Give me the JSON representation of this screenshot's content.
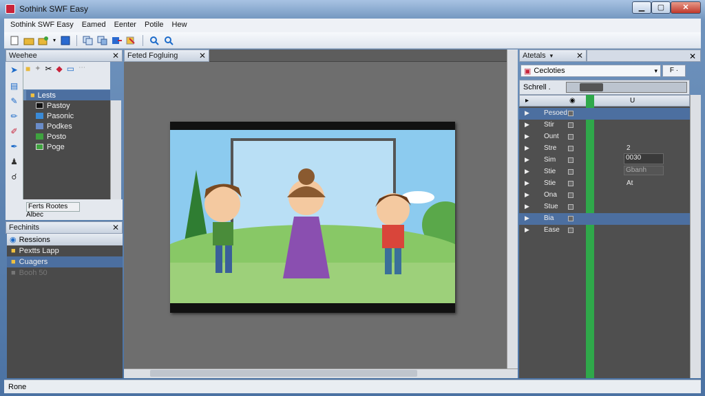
{
  "window": {
    "title": "Sothink SWF Easy",
    "minimize": "▁",
    "maximize": "▢",
    "close": "✕"
  },
  "menu": [
    "Sothink SWF Easy",
    "Eamed",
    "Eenter",
    "Potile",
    "Hew"
  ],
  "left_panel": {
    "title": "Weehee",
    "tree_header": "Lests",
    "tree_items": [
      {
        "label": "Pastoy",
        "color": "#111111"
      },
      {
        "label": "Pasonic",
        "color": "#3a8ad6"
      },
      {
        "label": "Podkes",
        "color": "#6a8cc8"
      },
      {
        "label": "Posto",
        "color": "#3fa33f"
      },
      {
        "label": "Poge",
        "color": "#3fa33f"
      }
    ],
    "bottom_label": "Ferts Rootes",
    "bottom_sub": "Albec"
  },
  "left_panel2": {
    "title": "Fechinits",
    "subheader": "Ressions",
    "rows": [
      {
        "label": "Pextts Lapp",
        "selected": false,
        "dim": false
      },
      {
        "label": "Cuagers",
        "selected": true,
        "dim": false
      },
      {
        "label": "Booh 50",
        "selected": false,
        "dim": true
      }
    ]
  },
  "document": {
    "tab": "Feted Fogluing"
  },
  "right_panel": {
    "title": "Atetals",
    "dropdown": "Cecloties",
    "dropdown_btn": "F ·",
    "toolbar_label": "Schrell .",
    "header_icon": "U",
    "layers": [
      {
        "name": "Pesoed",
        "selected": true,
        "value": ""
      },
      {
        "name": "Stir",
        "selected": false,
        "value": ""
      },
      {
        "name": "Ount",
        "selected": false,
        "value": ""
      },
      {
        "name": "Stre",
        "selected": false,
        "value": "2"
      },
      {
        "name": "Sim",
        "selected": false,
        "value": ""
      },
      {
        "name": "Stie",
        "selected": false,
        "value": ""
      },
      {
        "name": "Stie",
        "selected": false,
        "value": "At"
      },
      {
        "name": "Ona",
        "selected": false,
        "value": ""
      },
      {
        "name": "Stue",
        "selected": false,
        "value": ""
      },
      {
        "name": "Bia",
        "selected": true,
        "value": ""
      },
      {
        "name": "Ease",
        "selected": false,
        "value": ""
      }
    ],
    "box1": "0030",
    "box2": "Gbanh"
  },
  "status": "Rone"
}
